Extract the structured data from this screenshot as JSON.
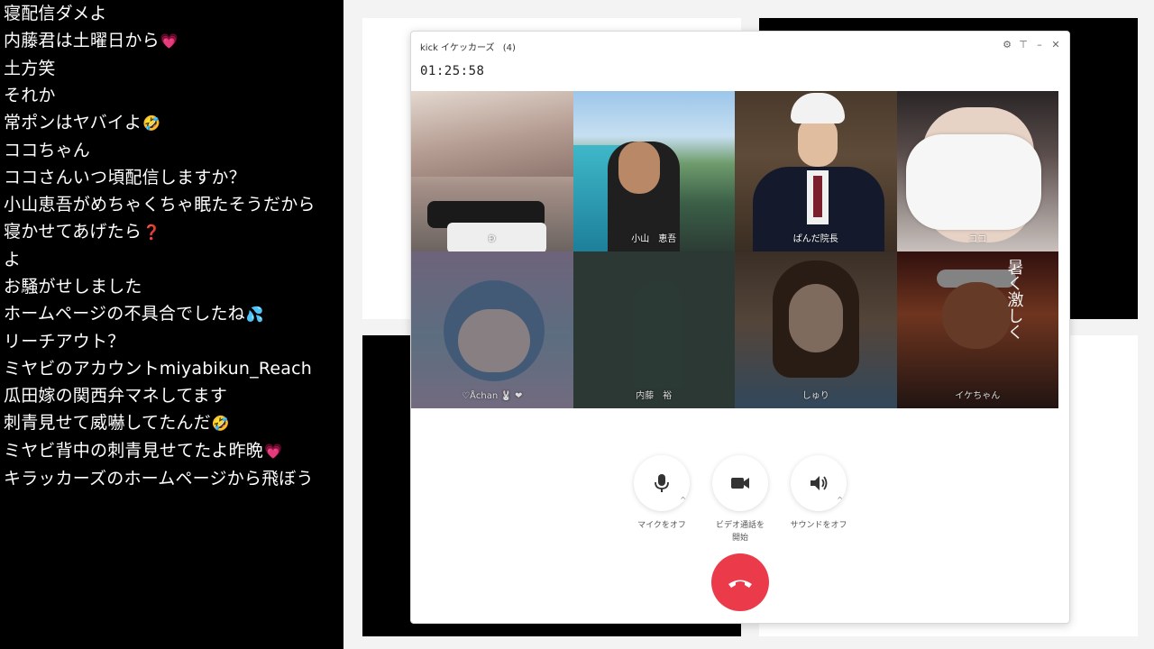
{
  "chat": {
    "messages": [
      {
        "text": "寝配信ダメよ",
        "emoji": ""
      },
      {
        "text": "内藤君は土曜日から",
        "emoji": "💗"
      },
      {
        "text": "土方笑",
        "emoji": ""
      },
      {
        "text": "それか",
        "emoji": ""
      },
      {
        "text": "常ポンはヤバイよ",
        "emoji": "🤣"
      },
      {
        "text": "ココちゃん",
        "emoji": ""
      },
      {
        "text": "ココさんいつ頃配信しますか？",
        "emoji": ""
      },
      {
        "text": "小山恵吾がめちゃくちゃ眠たそうだから",
        "emoji": ""
      },
      {
        "text": "寝かせてあげたら",
        "emoji": "❓"
      },
      {
        "text": "よ",
        "emoji": ""
      },
      {
        "text": "お騒がせしました",
        "emoji": ""
      },
      {
        "text": "ホームページの不具合でしたね",
        "emoji": "💦"
      },
      {
        "text": "リーチアウト？",
        "emoji": ""
      },
      {
        "text": "ミヤビのアカウントmiyabikun_Reach",
        "emoji": ""
      },
      {
        "text": "瓜田嫁の関西弁マネしてます",
        "emoji": ""
      },
      {
        "text": "刺青見せて威嚇してたんだ",
        "emoji": "🤣"
      },
      {
        "text": "ミヤビ背中の刺青見せてたよ昨晩",
        "emoji": "💗"
      },
      {
        "text": "キラッカーズのホームページから飛ぼう",
        "emoji": ""
      }
    ]
  },
  "call": {
    "title": "kick イケッカーズ",
    "count": "(4)",
    "timer": "01:25:58",
    "window_icons": [
      "gear-icon",
      "pin-icon",
      "minimize-icon",
      "close-icon"
    ],
    "participants": [
      {
        "name": "Ð",
        "active": true
      },
      {
        "name": "小山　恵吾",
        "active": true
      },
      {
        "name": "ぱんだ院長",
        "active": true
      },
      {
        "name": "ココ",
        "active": true
      },
      {
        "name": "♡Åchan 🐰 ❤",
        "active": false
      },
      {
        "name": "内藤　裕",
        "active": false
      },
      {
        "name": "しゅり",
        "active": false
      },
      {
        "name": "イケちゃん",
        "active": false
      }
    ],
    "tile_art": {
      "banner_text": "暑く激しく"
    },
    "controls": {
      "mic": {
        "icon": "microphone-icon",
        "label": "マイクをオフ"
      },
      "video": {
        "icon": "video-camera-icon",
        "label_line1": "ビデオ通話を",
        "label_line2": "開始"
      },
      "sound": {
        "icon": "speaker-icon",
        "label": "サウンドをオフ"
      },
      "hangup": {
        "icon": "phone-hangup-icon"
      }
    },
    "colors": {
      "hangup": "#eb3b4b"
    }
  }
}
